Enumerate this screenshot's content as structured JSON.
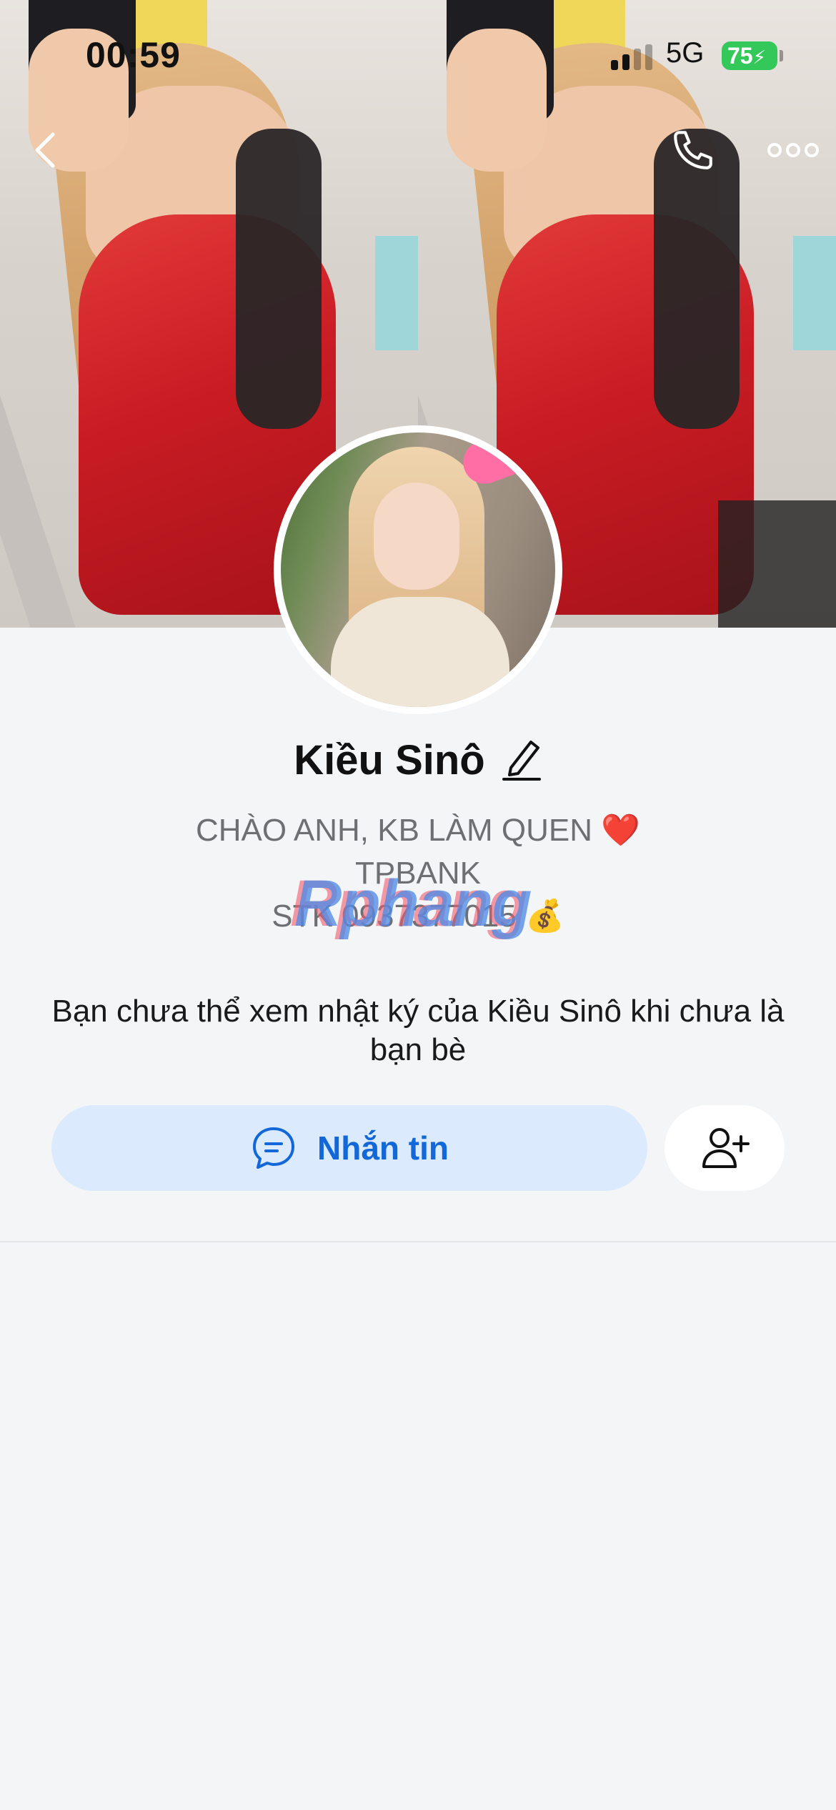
{
  "status_bar": {
    "time": "00:59",
    "network": "5G",
    "battery": "75"
  },
  "header": {
    "back_icon": "chevron-left-icon",
    "call_icon": "phone-icon",
    "more_icon": "more-horizontal-icon"
  },
  "profile": {
    "name": "Kiều Sinô",
    "edit_icon": "pencil-icon",
    "bio_lines": [
      "CHÀO ANH, KB LÀM QUEN ❤️",
      "TPBANK",
      "STK 0937377015 💰"
    ],
    "watermark": "Rphang",
    "privacy_notice": "Bạn chưa thể xem nhật ký của Kiều Sinô khi chưa là bạn bè"
  },
  "actions": {
    "message_label": "Nhắn tin",
    "message_icon": "chat-bubble-icon",
    "add_friend_icon": "add-user-icon"
  },
  "colors": {
    "accent": "#1268d8",
    "message_button_bg": "#dbeafc",
    "battery": "#34c759",
    "page_bg": "#f4f5f7"
  }
}
